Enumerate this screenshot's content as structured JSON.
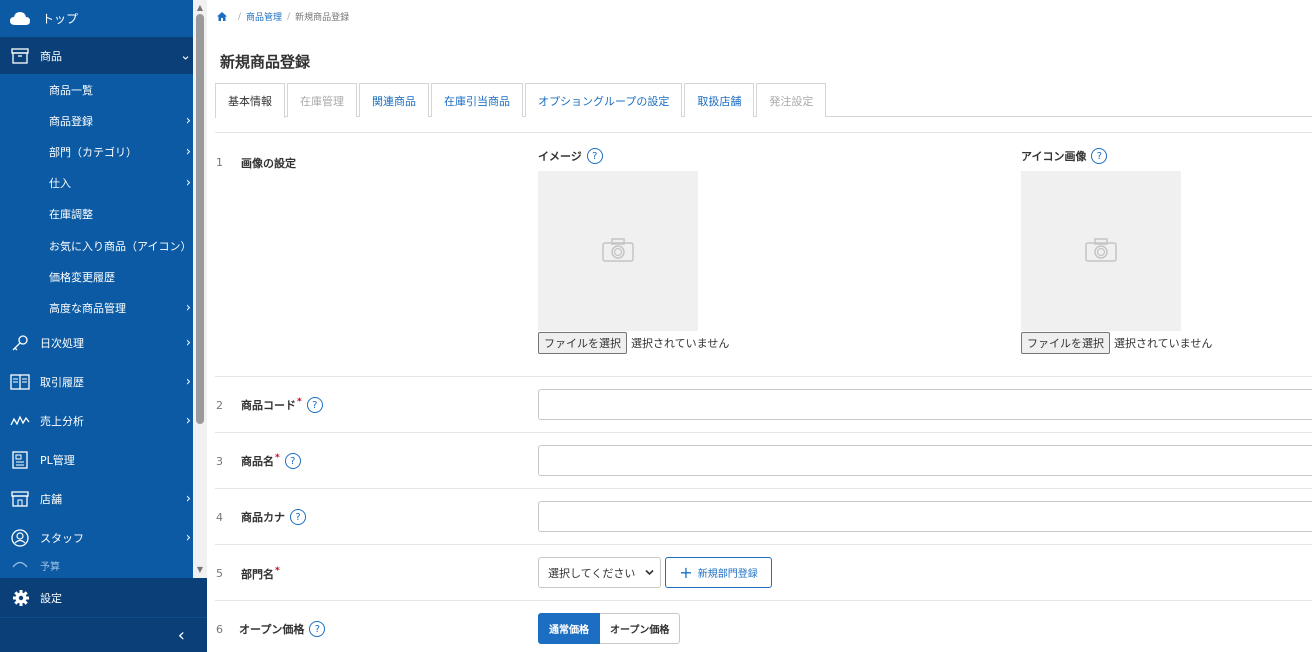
{
  "sidebar": {
    "top_label": "トップ",
    "product": {
      "label": "商品",
      "subitems": [
        {
          "label": "商品一覧",
          "has_arrow": false
        },
        {
          "label": "商品登録",
          "has_arrow": true
        },
        {
          "label": "部門（カテゴリ）",
          "has_arrow": true
        },
        {
          "label": "仕入",
          "has_arrow": true
        },
        {
          "label": "在庫調整",
          "has_arrow": false
        },
        {
          "label": "お気に入り商品（アイコン）",
          "has_arrow": false
        },
        {
          "label": "価格変更履歴",
          "has_arrow": false
        },
        {
          "label": "高度な商品管理",
          "has_arrow": true
        }
      ]
    },
    "main_items": [
      {
        "label": "日次処理",
        "icon": "key-icon"
      },
      {
        "label": "取引履歴",
        "icon": "ledger-icon"
      },
      {
        "label": "売上分析",
        "icon": "chart-line-icon"
      },
      {
        "label": "PL管理",
        "icon": "pl-doc-icon"
      },
      {
        "label": "店舗",
        "icon": "store-icon"
      },
      {
        "label": "スタッフ",
        "icon": "staff-icon"
      }
    ],
    "partial_item": "予算",
    "settings_label": "設定",
    "collapse_glyph": "‹"
  },
  "breadcrumb": {
    "items": [
      "商品管理",
      "新規商品登録"
    ]
  },
  "page": {
    "title": "新規商品登録"
  },
  "tabs": [
    {
      "label": "基本情報",
      "state": "active"
    },
    {
      "label": "在庫管理",
      "state": "disabled"
    },
    {
      "label": "関連商品",
      "state": "link"
    },
    {
      "label": "在庫引当商品",
      "state": "link"
    },
    {
      "label": "オプショングループの設定",
      "state": "link"
    },
    {
      "label": "取扱店舗",
      "state": "link"
    },
    {
      "label": "発注設定",
      "state": "disabled"
    }
  ],
  "form": {
    "image_row": {
      "num": "1",
      "label": "画像の設定",
      "image_label": "イメージ",
      "icon_label": "アイコン画像",
      "file_button": "ファイルを選択",
      "no_file": "選択されていません"
    },
    "product_code": {
      "num": "2",
      "label": "商品コード"
    },
    "product_name": {
      "num": "3",
      "label": "商品名"
    },
    "product_kana": {
      "num": "4",
      "label": "商品カナ"
    },
    "category": {
      "num": "5",
      "label": "部門名",
      "select_value": "選択してください",
      "new_button": "新規部門登録"
    },
    "open_price": {
      "num": "6",
      "label": "オープン価格",
      "option_on": "通常価格",
      "option_off": "オープン価格"
    },
    "help_glyph": "?",
    "required_mark": "*"
  },
  "colors": {
    "sidebar_bg": "#0b5aa3",
    "sidebar_active": "#0a3f78",
    "accent": "#1b6ec2",
    "required": "#d0021b"
  }
}
